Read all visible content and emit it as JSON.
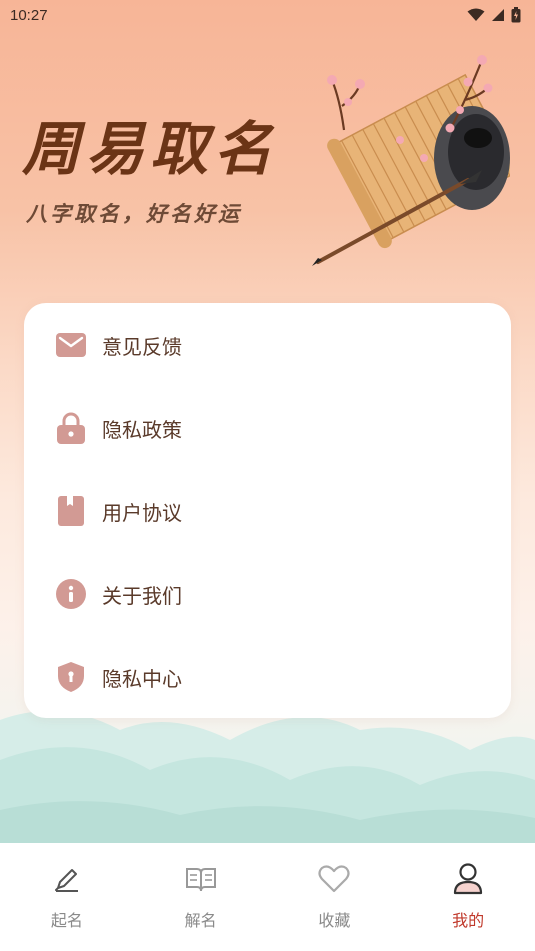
{
  "status_bar": {
    "time": "10:27"
  },
  "hero": {
    "title": "周易取名",
    "subtitle": "八字取名，好名好运"
  },
  "menu": {
    "items": [
      {
        "label": "意见反馈",
        "icon": "mail-icon"
      },
      {
        "label": "隐私政策",
        "icon": "lock-icon"
      },
      {
        "label": "用户协议",
        "icon": "book-icon"
      },
      {
        "label": "关于我们",
        "icon": "info-icon"
      },
      {
        "label": "隐私中心",
        "icon": "shield-icon"
      }
    ]
  },
  "tabbar": {
    "tabs": [
      {
        "label": "起名",
        "icon": "pencil-icon",
        "active": false
      },
      {
        "label": "解名",
        "icon": "open-book-icon",
        "active": false
      },
      {
        "label": "收藏",
        "icon": "heart-icon",
        "active": false
      },
      {
        "label": "我的",
        "icon": "user-icon",
        "active": true
      }
    ]
  },
  "colors": {
    "icon_accent": "#d29a94",
    "active_tab": "#c0392b",
    "text": "#5a3a2a"
  }
}
